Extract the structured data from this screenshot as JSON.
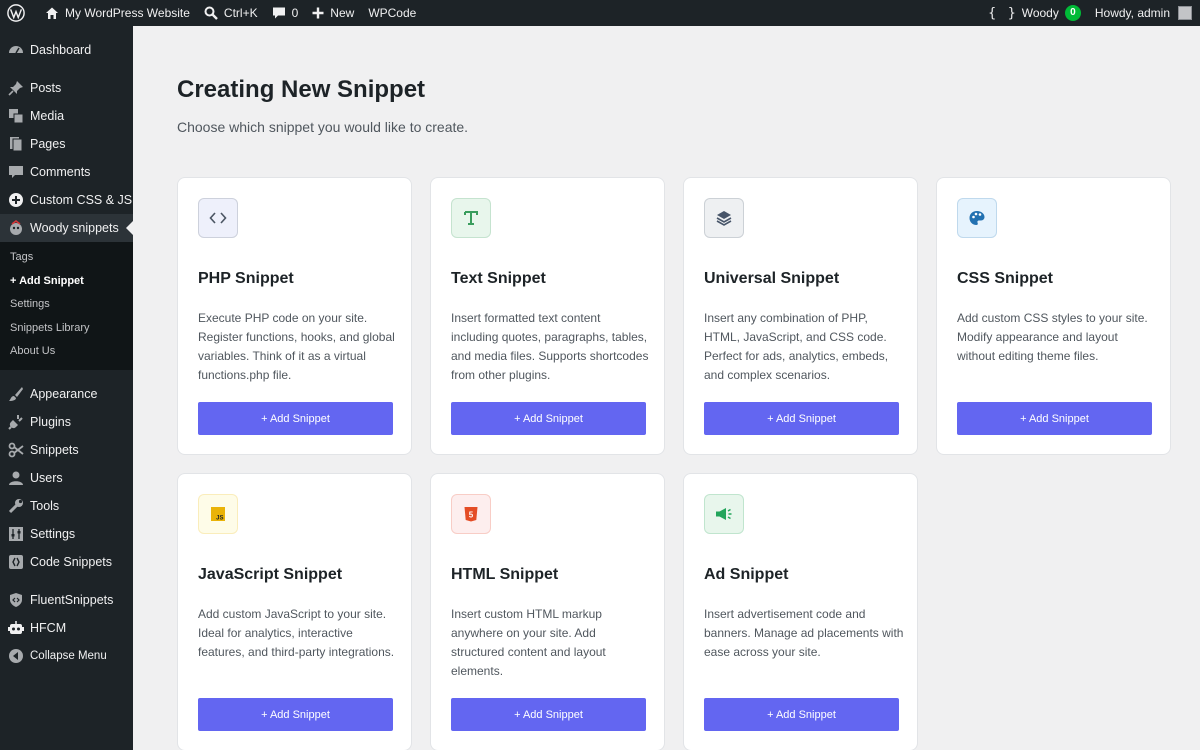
{
  "adminbar": {
    "site_name": "My WordPress Website",
    "search_shortcut": "Ctrl+K",
    "comments_count": "0",
    "new_label": "New",
    "wpcode_label": "WPCode",
    "woody_label": "Woody",
    "woody_badge": "0",
    "howdy": "Howdy, admin"
  },
  "sidebar": {
    "dashboard": "Dashboard",
    "posts": "Posts",
    "media": "Media",
    "pages": "Pages",
    "comments": "Comments",
    "custom_css_js": "Custom CSS & JS",
    "woody_snippets": "Woody snippets",
    "submenu": [
      "Tags",
      "+ Add Snippet",
      "Settings",
      "Snippets Library",
      "About Us"
    ],
    "appearance": "Appearance",
    "plugins": "Plugins",
    "snippets": "Snippets",
    "users": "Users",
    "tools": "Tools",
    "settings": "Settings",
    "code_snippets": "Code Snippets",
    "fluent_snippets": "FluentSnippets",
    "hfcm": "HFCM",
    "collapse": "Collapse Menu"
  },
  "main": {
    "title": "Creating New Snippet",
    "subtitle": "Choose which snippet you would like to create.",
    "cards": [
      {
        "title": "PHP Snippet",
        "description": "Execute PHP code on your site. Register functions, hooks, and global variables. Think of it as a virtual functions.php file.",
        "button": "+ Add Snippet",
        "icon": "code-icon",
        "icon_bg": "#eef0fb",
        "icon_color": "#4b5563"
      },
      {
        "title": "Text Snippet",
        "description": "Insert formatted text content including quotes, paragraphs, tables, and media files. Supports shortcodes from other plugins.",
        "button": "+ Add Snippet",
        "icon": "text-icon",
        "icon_bg": "#e8f6ec",
        "icon_color": "#3a9d5d"
      },
      {
        "title": "Universal Snippet",
        "description": "Insert any combination of PHP, HTML, JavaScript, and CSS code. Perfect for ads, analytics, embeds, and complex scenarios.",
        "button": "+ Add Snippet",
        "icon": "layers-icon",
        "icon_bg": "#eef0f2",
        "icon_color": "#475569"
      },
      {
        "title": "CSS Snippet",
        "description": "Add custom CSS styles to your site. Modify appearance and layout without editing theme files.",
        "button": "+ Add Snippet",
        "icon": "palette-icon",
        "icon_bg": "#e6f3fd",
        "icon_color": "#2271b1"
      },
      {
        "title": "JavaScript Snippet",
        "description": "Add custom JavaScript to your site. Ideal for analytics, interactive features, and third-party integrations.",
        "button": "+ Add Snippet",
        "icon": "js-icon",
        "icon_bg": "#fefce8",
        "icon_color": "#eab308"
      },
      {
        "title": "HTML Snippet",
        "description": "Insert custom HTML markup anywhere on your site. Add structured content and layout elements.",
        "button": "+ Add Snippet",
        "icon": "html5-icon",
        "icon_bg": "#fdeeee",
        "icon_color": "#e44d26"
      },
      {
        "title": "Ad Snippet",
        "description": "Insert advertisement code and banners. Manage ad placements with ease across your site.",
        "button": "+ Add Snippet",
        "icon": "megaphone-icon",
        "icon_bg": "#e8f6ec",
        "icon_color": "#22a55b"
      }
    ]
  }
}
